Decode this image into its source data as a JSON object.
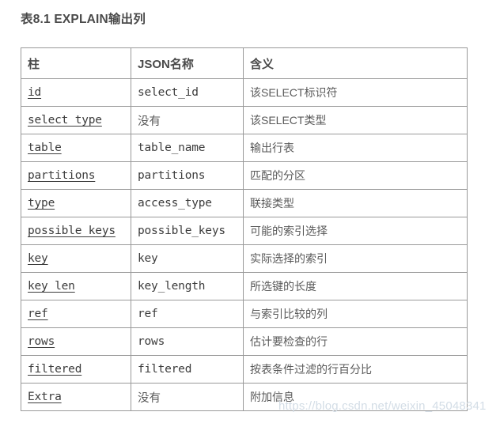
{
  "page_title": "表8.1 EXPLAIN输出列",
  "watermark": "https://blog.csdn.net/weixin_45048341",
  "table": {
    "headers": [
      "柱",
      "JSON名称",
      "含义"
    ],
    "rows": [
      {
        "column": "id",
        "json_name": "select_id",
        "meaning": "该SELECT标识符",
        "json_name_is_code": true
      },
      {
        "column": "select type",
        "json_name": "没有",
        "meaning": "该SELECT类型",
        "json_name_is_code": false
      },
      {
        "column": "table",
        "json_name": "table_name",
        "meaning": "输出行表",
        "json_name_is_code": true
      },
      {
        "column": "partitions",
        "json_name": "partitions",
        "meaning": "匹配的分区",
        "json_name_is_code": true
      },
      {
        "column": "type",
        "json_name": "access_type",
        "meaning": "联接类型",
        "json_name_is_code": true
      },
      {
        "column": "possible keys",
        "json_name": "possible_keys",
        "meaning": "可能的索引选择",
        "json_name_is_code": true
      },
      {
        "column": "key",
        "json_name": "key",
        "meaning": "实际选择的索引",
        "json_name_is_code": true
      },
      {
        "column": "key len",
        "json_name": "key_length",
        "meaning": "所选键的长度",
        "json_name_is_code": true
      },
      {
        "column": "ref",
        "json_name": "ref",
        "meaning": "与索引比较的列",
        "json_name_is_code": true
      },
      {
        "column": "rows",
        "json_name": "rows",
        "meaning": "估计要检查的行",
        "json_name_is_code": true
      },
      {
        "column": "filtered",
        "json_name": "filtered",
        "meaning": "按表条件过滤的行百分比",
        "json_name_is_code": true
      },
      {
        "column": "Extra",
        "json_name": "没有",
        "meaning": "附加信息",
        "json_name_is_code": false
      }
    ]
  },
  "colors": {
    "border": "#9a9a9a",
    "title_text": "#4a4a4a",
    "code_text": "#3c3c3c",
    "cn_text": "#5a5a5a",
    "watermark": "#d3dde6",
    "background": "#ffffff"
  }
}
